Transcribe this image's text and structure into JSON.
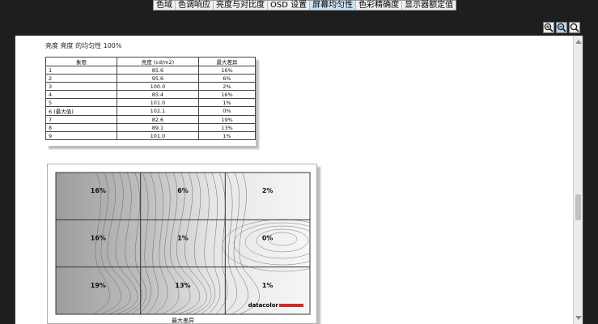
{
  "tabs": [
    {
      "label": "色域",
      "active": false
    },
    {
      "label": "色调响应",
      "active": false
    },
    {
      "label": "亮度与对比度",
      "active": false
    },
    {
      "label": "OSD 设置",
      "active": false
    },
    {
      "label": "屏幕均匀性",
      "active": true
    },
    {
      "label": "色彩精确度",
      "active": false
    },
    {
      "label": "显示器额定值",
      "active": false
    }
  ],
  "zoom": {
    "zoom_in": "zoom-in-icon",
    "zoom_out": "zoom-out-icon",
    "zoom_reset": "zoom-reset-icon"
  },
  "report": {
    "heading": "亮度 亮度 的均匀性 100%",
    "table": {
      "headers": [
        "象限",
        "亮度 (cd/m2)",
        "最大差异"
      ],
      "rows": [
        [
          "1",
          "85.6",
          "16%"
        ],
        [
          "2",
          "95.6",
          "6%"
        ],
        [
          "3",
          "100.0",
          "2%"
        ],
        [
          "4",
          "85.4",
          "16%"
        ],
        [
          "5",
          "101.0",
          "1%"
        ],
        [
          "6 (最大值)",
          "102.1",
          "0%"
        ],
        [
          "7",
          "82.6",
          "19%"
        ],
        [
          "8",
          "89.1",
          "13%"
        ],
        [
          "9",
          "101.0",
          "1%"
        ]
      ]
    },
    "contour": {
      "cells": [
        "16%",
        "6%",
        "2%",
        "16%",
        "1%",
        "0%",
        "19%",
        "13%",
        "1%"
      ],
      "brand": "datacolor",
      "caption": "最大差异",
      "shade_colors": [
        "#9d9d9d",
        "#c2c2c2",
        "#e6e6e6",
        "#f6f6f6"
      ]
    }
  }
}
